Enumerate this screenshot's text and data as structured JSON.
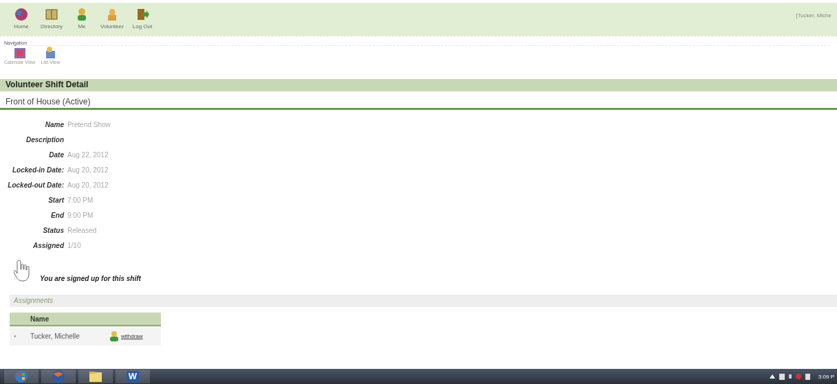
{
  "toolbar": {
    "items": [
      {
        "label": "Home",
        "kind": "home"
      },
      {
        "label": "Directory",
        "kind": "directory"
      },
      {
        "label": "Me",
        "kind": "me"
      },
      {
        "label": "Volunteer",
        "kind": "volunteer"
      },
      {
        "label": "Log Out",
        "kind": "logout"
      }
    ],
    "user": "[Tucker, Miche"
  },
  "navigation": {
    "title": "Navigation",
    "items": [
      {
        "label": "Calendar View",
        "kind": "calendar"
      },
      {
        "label": "List View",
        "kind": "list"
      }
    ]
  },
  "page_title": "Volunteer Shift Detail",
  "shift": {
    "title": "Front of House (Active)",
    "fields": [
      {
        "label": "Name",
        "value": "Pretend Show"
      },
      {
        "label": "Description"
      },
      {
        "label": "Date",
        "value": "Aug 22, 2012"
      },
      {
        "label": "Locked-in Date:",
        "value": "Aug 20, 2012"
      },
      {
        "label": "Locked-out Date:",
        "value": "Aug 20, 2012"
      },
      {
        "label": "Start",
        "value": "7:00 PM"
      },
      {
        "label": "End",
        "value": "9:00 PM"
      },
      {
        "label": "Status",
        "value": "Released"
      },
      {
        "label": "Assigned",
        "value": "1/10"
      }
    ],
    "signup_message": "You are signed up for this shift"
  },
  "assignments": {
    "title": "Assignments",
    "columns": [
      "Name"
    ],
    "rows": [
      {
        "marker": "•",
        "name": "Tucker, Michelle",
        "action": "withdraw"
      }
    ]
  },
  "taskbar": {
    "apps": [
      {
        "kind": "start"
      },
      {
        "kind": "browser"
      },
      {
        "kind": "folder"
      },
      {
        "kind": "word",
        "letter": "W"
      }
    ],
    "clock": "3:09 P"
  }
}
